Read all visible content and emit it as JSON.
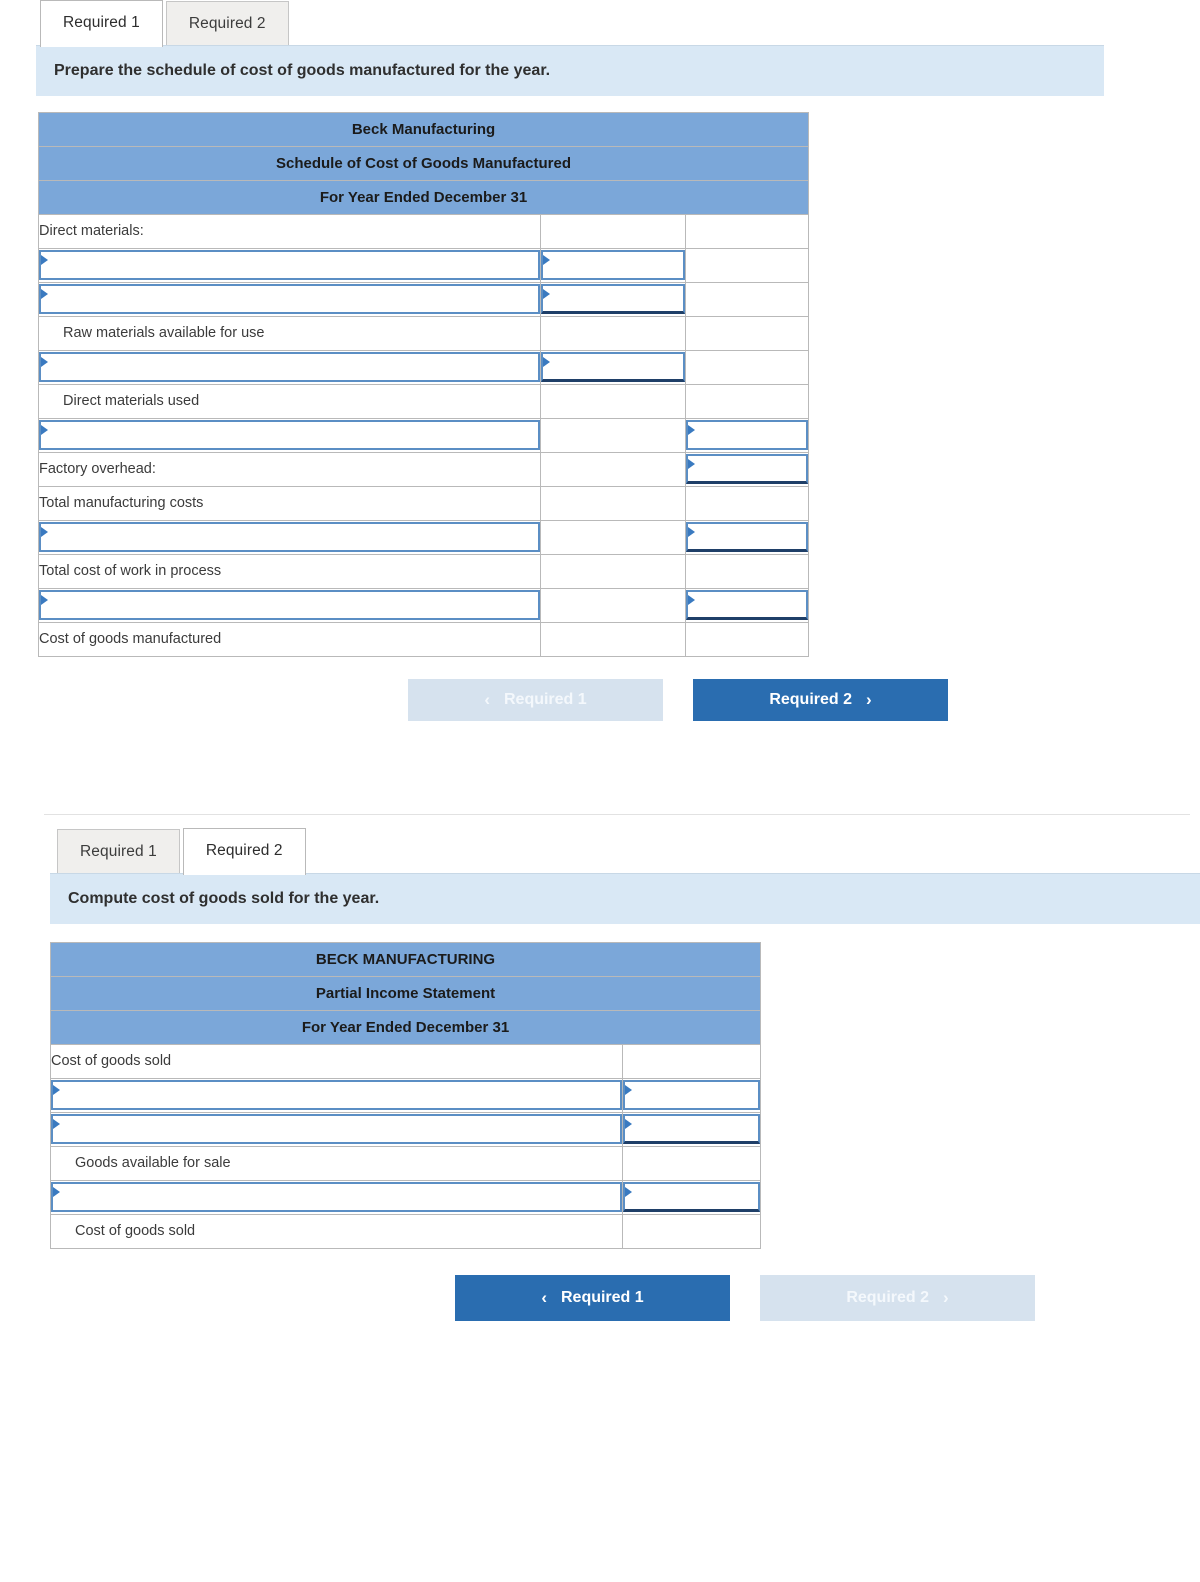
{
  "panel1": {
    "tabs": [
      {
        "label": "Required 1",
        "active": true
      },
      {
        "label": "Required 2",
        "active": false
      }
    ],
    "instruction": "Prepare the schedule of cost of goods manufactured for the year.",
    "table": {
      "title_lines": [
        "Beck Manufacturing",
        "Schedule of Cost of Goods Manufactured",
        "For Year Ended December 31"
      ],
      "rows": [
        {
          "label": "Direct materials:",
          "indent": false,
          "input_label": false,
          "col2": "none",
          "col3": "none"
        },
        {
          "label": "",
          "indent": false,
          "input_label": true,
          "col2": "input",
          "col3": "none"
        },
        {
          "label": "",
          "indent": false,
          "input_label": true,
          "col2": "input-deep",
          "col3": "none"
        },
        {
          "label": "Raw materials available for use",
          "indent": true,
          "input_label": false,
          "col2": "none",
          "col3": "none"
        },
        {
          "label": "",
          "indent": false,
          "input_label": true,
          "col2": "input-deep",
          "col3": "none"
        },
        {
          "label": "Direct materials used",
          "indent": true,
          "input_label": false,
          "col2": "none",
          "col3": "none"
        },
        {
          "label": "",
          "indent": false,
          "input_label": true,
          "col2": "none",
          "col3": "input"
        },
        {
          "label": "Factory overhead:",
          "indent": false,
          "input_label": false,
          "col2": "none",
          "col3": "input-deep"
        },
        {
          "label": "Total manufacturing costs",
          "indent": false,
          "input_label": false,
          "col2": "none",
          "col3": "none"
        },
        {
          "label": "",
          "indent": false,
          "input_label": true,
          "col2": "none",
          "col3": "input-deep"
        },
        {
          "label": "Total cost of work in process",
          "indent": false,
          "input_label": false,
          "col2": "none",
          "col3": "none"
        },
        {
          "label": "",
          "indent": false,
          "input_label": true,
          "col2": "none",
          "col3": "input-deep"
        },
        {
          "label": "Cost of goods manufactured",
          "indent": false,
          "input_label": false,
          "col2": "none",
          "col3": "underline"
        }
      ]
    },
    "nav": {
      "prev": {
        "label": "Required 1",
        "chevron": "‹",
        "state": "disabled"
      },
      "next": {
        "label": "Required 2",
        "chevron": "›",
        "state": "primary"
      }
    }
  },
  "panel2": {
    "tabs": [
      {
        "label": "Required 1",
        "active": false
      },
      {
        "label": "Required 2",
        "active": true
      }
    ],
    "instruction": "Compute cost of goods sold for the year.",
    "table": {
      "title_lines": [
        "BECK MANUFACTURING",
        "Partial Income Statement",
        "For Year Ended December 31"
      ],
      "rows": [
        {
          "label": "Cost of goods sold",
          "indent": false,
          "input_label": false,
          "col2": "none"
        },
        {
          "label": "",
          "indent": false,
          "input_label": true,
          "col2": "input"
        },
        {
          "label": "",
          "indent": false,
          "input_label": true,
          "col2": "input-deep"
        },
        {
          "label": "Goods available for sale",
          "indent": true,
          "input_label": false,
          "col2": "none"
        },
        {
          "label": "",
          "indent": false,
          "input_label": true,
          "col2": "input-deep"
        },
        {
          "label": "Cost of goods sold",
          "indent": true,
          "input_label": false,
          "col2": "underline"
        }
      ]
    },
    "nav": {
      "prev": {
        "label": "Required 1",
        "chevron": "‹",
        "state": "primary"
      },
      "next": {
        "label": "Required 2",
        "chevron": "›",
        "state": "disabled"
      }
    }
  },
  "colors": {
    "header_blue": "#7ba7d9",
    "banner_blue": "#d9e8f5",
    "button_primary": "#2a6db0",
    "button_disabled": "#d6e2ee",
    "input_border": "#5b8ec4"
  }
}
